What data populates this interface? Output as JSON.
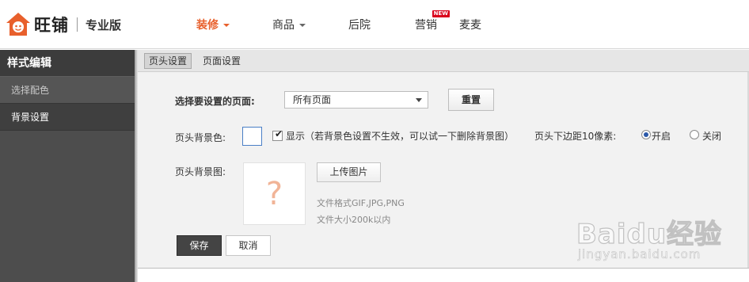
{
  "brand": {
    "name": "旺铺",
    "edition": "专业版"
  },
  "nav": {
    "items": [
      {
        "label": "装修",
        "active": true,
        "dropdown": true
      },
      {
        "label": "商品",
        "active": false,
        "dropdown": true
      },
      {
        "label": "后院",
        "active": false,
        "dropdown": false
      },
      {
        "label": "营销",
        "active": false,
        "dropdown": false,
        "badge": "NEW"
      },
      {
        "label": "麦麦",
        "active": false,
        "dropdown": false
      }
    ]
  },
  "sidebar": {
    "title": "样式编辑",
    "items": [
      {
        "label": "选择配色"
      },
      {
        "label": "背景设置"
      }
    ]
  },
  "tabs": [
    {
      "label": "页头设置",
      "active": true
    },
    {
      "label": "页面设置",
      "active": false
    }
  ],
  "form": {
    "page_select_label": "选择要设置的页面:",
    "page_select_value": "所有页面",
    "reset_label": "重置",
    "header_bg_color_label": "页头背景色:",
    "show_checkbox_label": "显示（若背景色设置不生效，可以试一下删除背景图）",
    "bottom_margin_label": "页头下边距10像素:",
    "radio_on_label": "开启",
    "radio_off_label": "关闭",
    "header_bg_image_label": "页头背景图:",
    "preview_placeholder": "?",
    "upload_label": "上传图片",
    "hint_formats": "文件格式GIF,JPG,PNG",
    "hint_size": "文件大小200k以内",
    "save_label": "保存",
    "cancel_label": "取消"
  },
  "watermark": {
    "main": "Baidu经验",
    "sub": "jingyan.baidu.com"
  },
  "colors": {
    "accent": "#e8602c",
    "sidebar_bg": "#4d4d4d",
    "badge": "#d9001b"
  }
}
